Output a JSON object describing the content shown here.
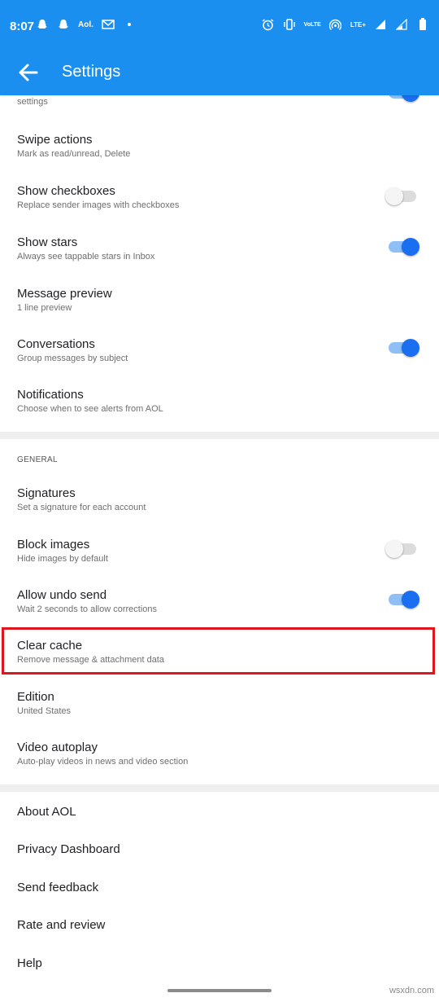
{
  "status_bar": {
    "time": "8:07",
    "left_icons": [
      "snapchat-icon",
      "snapchat-icon",
      "aol-icon",
      "mail-icon",
      "dot-icon"
    ],
    "aol_text": "Aol.",
    "volte_text": "VoLTE",
    "lte_text": "LTE+",
    "right_icons": [
      "alarm-icon",
      "vibrate-icon",
      "volte-icon",
      "hotspot-icon",
      "lte-icon",
      "signal-icon",
      "signal-icon",
      "battery-icon"
    ]
  },
  "app_bar": {
    "title": "Settings"
  },
  "partial_item": {
    "subtitle": "settings"
  },
  "items": [
    {
      "title": "Swipe actions",
      "subtitle": "Mark as read/unread, Delete",
      "toggle": null
    },
    {
      "title": "Show checkboxes",
      "subtitle": "Replace sender images with checkboxes",
      "toggle": "off"
    },
    {
      "title": "Show stars",
      "subtitle": "Always see tappable stars in Inbox",
      "toggle": "on"
    },
    {
      "title": "Message preview",
      "subtitle": "1 line preview",
      "toggle": null
    },
    {
      "title": "Conversations",
      "subtitle": "Group messages by subject",
      "toggle": "on"
    },
    {
      "title": "Notifications",
      "subtitle": "Choose when to see alerts from AOL",
      "toggle": null
    }
  ],
  "general_section": {
    "header": "GENERAL",
    "items": [
      {
        "title": "Signatures",
        "subtitle": "Set a signature for each account",
        "toggle": null
      },
      {
        "title": "Block images",
        "subtitle": "Hide images by default",
        "toggle": "off"
      },
      {
        "title": "Allow undo send",
        "subtitle": "Wait 2 seconds to allow corrections",
        "toggle": "on"
      },
      {
        "title": "Clear cache",
        "subtitle": "Remove message & attachment data",
        "toggle": null
      },
      {
        "title": "Edition",
        "subtitle": "United States",
        "toggle": null
      },
      {
        "title": "Video autoplay",
        "subtitle": "Auto-play videos in news and video section",
        "toggle": null
      }
    ]
  },
  "bottom_items": [
    {
      "title": "About AOL"
    },
    {
      "title": "Privacy Dashboard"
    },
    {
      "title": "Send feedback"
    },
    {
      "title": "Rate and review"
    },
    {
      "title": "Help"
    }
  ],
  "highlight_color": "#e0161f",
  "accent_color": "#1a8ff0",
  "watermark": "wsxdn.com"
}
